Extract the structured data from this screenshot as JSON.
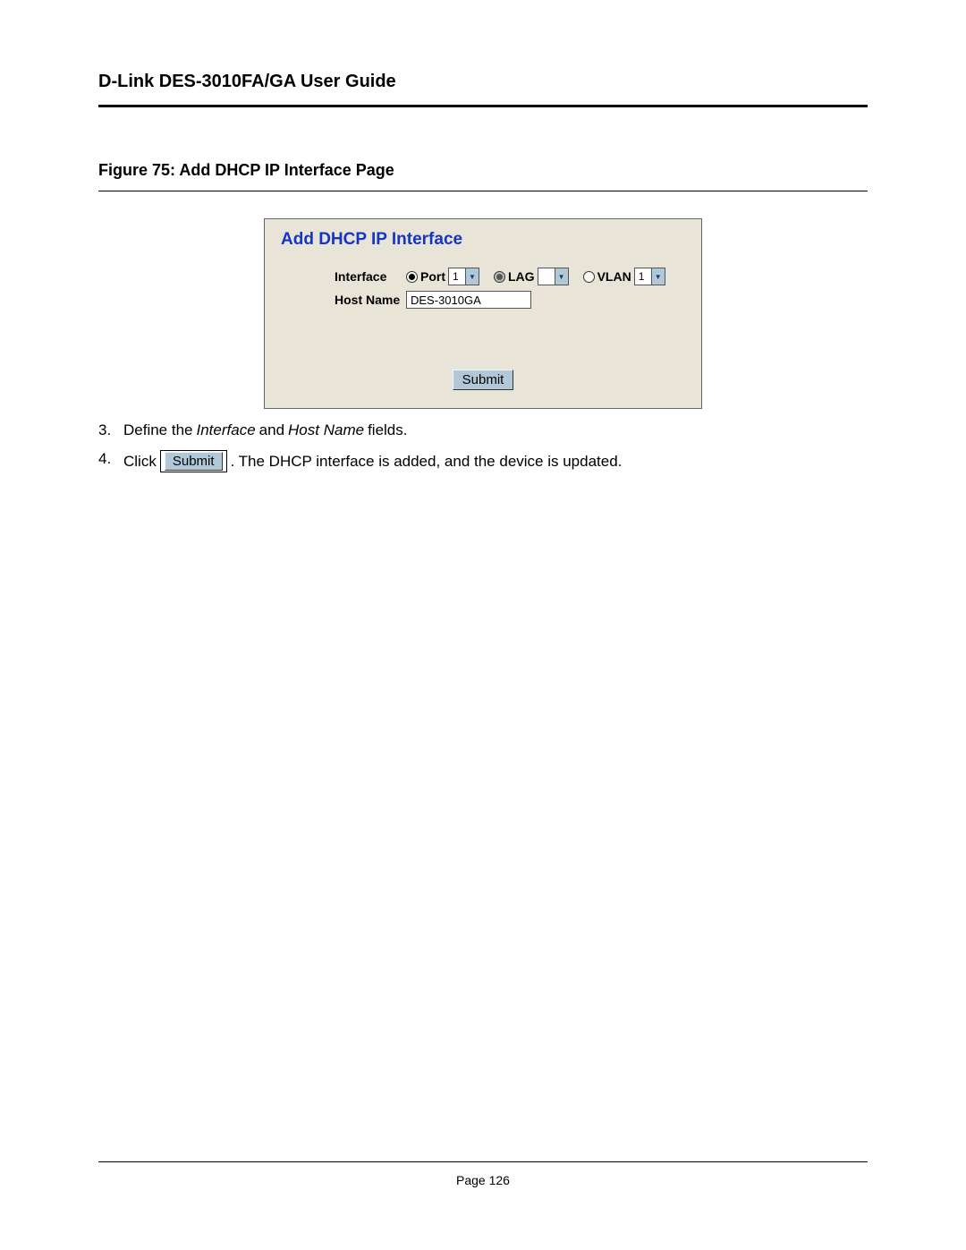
{
  "header": {
    "title": "D-Link DES-3010FA/GA User Guide"
  },
  "figure": {
    "caption": "Figure 75:  Add DHCP IP Interface Page"
  },
  "panel": {
    "title": "Add DHCP IP Interface",
    "rows": {
      "interface_label": "Interface",
      "hostname_label": "Host Name",
      "hostname_value": "DES-3010GA",
      "port_label": "Port",
      "port_value": "1",
      "lag_label": "LAG",
      "lag_value": "",
      "vlan_label": "VLAN",
      "vlan_value": "1"
    },
    "submit_label": "Submit"
  },
  "steps": {
    "s3": {
      "num": "3.",
      "t1": "Define the ",
      "i1": "Interface",
      "t2": " and ",
      "i2": "Host Name",
      "t3": " fields."
    },
    "s4": {
      "num": "4.",
      "t1": "Click  ",
      "btn": "Submit",
      "t2": ". The DHCP interface is added, and the device is updated."
    }
  },
  "footer": {
    "page_label": "Page 126"
  }
}
